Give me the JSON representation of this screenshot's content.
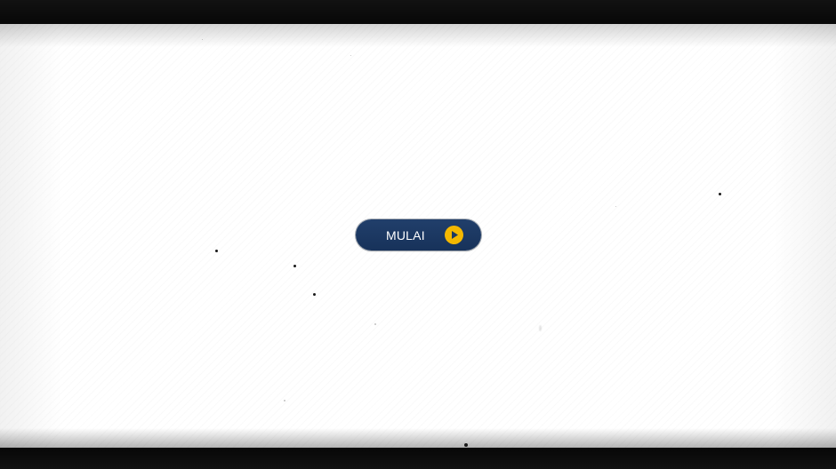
{
  "screen": {
    "start_button": {
      "label": "MULAI",
      "icon": "play-circle-icon",
      "background_color": "#1b3761",
      "icon_color": "#f4b800"
    }
  }
}
